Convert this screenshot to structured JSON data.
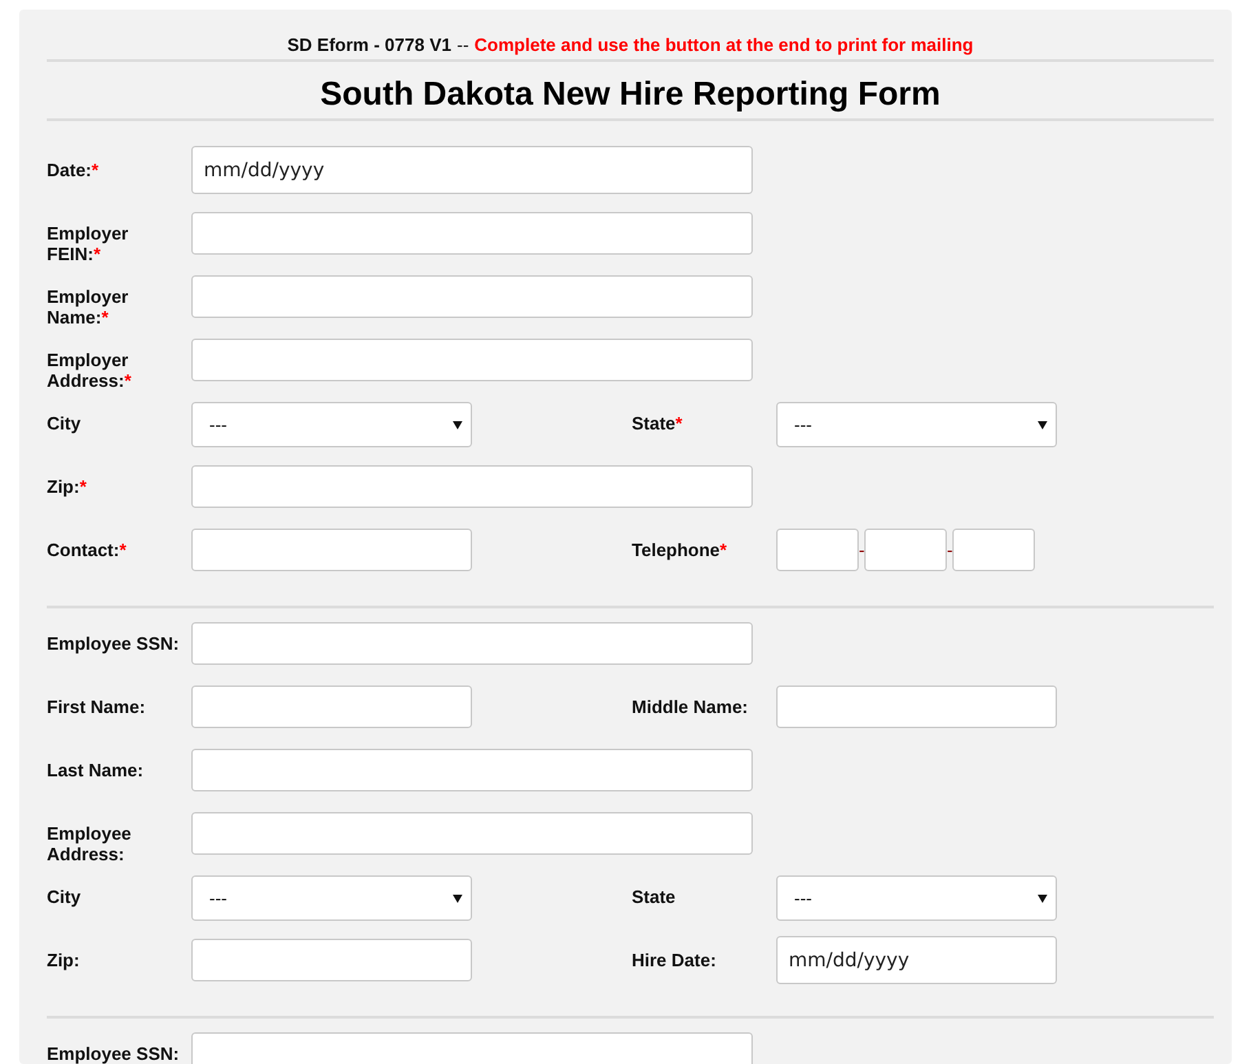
{
  "header": {
    "form_id": "SD Eform - 0778 V1",
    "separator": "--",
    "instruction": "Complete and use the button at the end to print for mailing"
  },
  "title": "South Dakota New Hire Reporting Form",
  "sections": [
    {
      "rows": [
        [
          {
            "label_lines": [
              "Date:"
            ],
            "required_mark": "*",
            "kind": "date",
            "placeholder": "mm/dd/yyyy"
          }
        ],
        [
          {
            "label_lines": [
              "Employer",
              "FEIN:"
            ],
            "required_mark": "*",
            "kind": "text"
          }
        ],
        [
          {
            "label_lines": [
              "Employer",
              "Name:"
            ],
            "required_mark": "*",
            "kind": "text"
          }
        ],
        [
          {
            "label_lines": [
              "Employer",
              "Address:"
            ],
            "required_mark": "*",
            "kind": "text"
          }
        ],
        [
          {
            "label_lines": [
              "City"
            ],
            "kind": "select",
            "value": "---"
          },
          {
            "label_lines": [
              "State"
            ],
            "required_mark": "*",
            "kind": "select",
            "value": "---"
          }
        ],
        [
          {
            "label_lines": [
              "Zip:"
            ],
            "required_mark": "*",
            "kind": "text"
          }
        ],
        [
          {
            "label_lines": [
              "Contact:"
            ],
            "required_mark": "*",
            "kind": "text"
          },
          {
            "label_lines": [
              "Telephone"
            ],
            "required_mark": "*",
            "kind": "phone",
            "separators": [
              "-",
              "-"
            ]
          }
        ]
      ]
    },
    {
      "rows": [
        [
          {
            "label_lines": [
              "Employee SSN:"
            ],
            "kind": "text"
          }
        ],
        [
          {
            "label_lines": [
              "First Name:"
            ],
            "kind": "text"
          },
          {
            "label_lines": [
              "Middle Name:"
            ],
            "kind": "text"
          }
        ],
        [
          {
            "label_lines": [
              "Last Name:"
            ],
            "kind": "text"
          }
        ],
        [
          {
            "label_lines": [
              "Employee",
              "Address:"
            ],
            "kind": "text"
          }
        ],
        [
          {
            "label_lines": [
              "City"
            ],
            "kind": "select",
            "value": "---"
          },
          {
            "label_lines": [
              "State"
            ],
            "kind": "select",
            "value": "---"
          }
        ],
        [
          {
            "label_lines": [
              "Zip:"
            ],
            "kind": "text"
          },
          {
            "label_lines": [
              "Hire Date:"
            ],
            "kind": "date",
            "placeholder": "mm/dd/yyyy"
          }
        ]
      ]
    },
    {
      "rows": [
        [
          {
            "label_lines": [
              "Employee SSN:"
            ],
            "kind": "text"
          }
        ]
      ]
    }
  ]
}
